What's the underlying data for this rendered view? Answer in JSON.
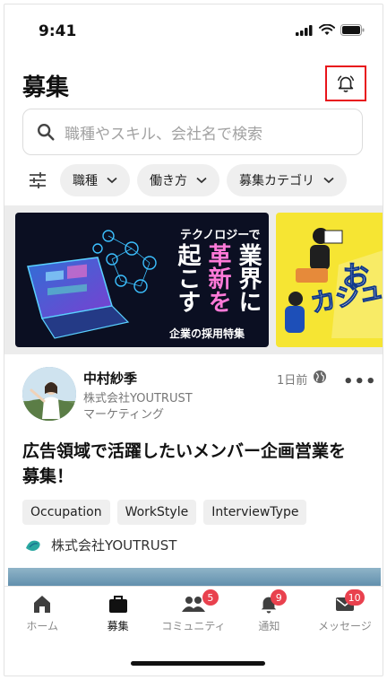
{
  "status_bar": {
    "time": "9:41"
  },
  "header": {
    "title": "募集"
  },
  "search": {
    "placeholder": "職種やスキル、会社名で検索"
  },
  "filters": [
    {
      "label": "職種"
    },
    {
      "label": "働き方"
    },
    {
      "label": "募集カテゴリ"
    }
  ],
  "banners": [
    {
      "top_text": "テクノロジーで",
      "columns": [
        "起こす",
        "革新を",
        "業界に"
      ],
      "bottom_text": "企業の採用特集"
    },
    {
      "text_line1": "お",
      "text_line2": "カジュ"
    }
  ],
  "post": {
    "author_name": "中村紗季",
    "company": "株式会社YOUTRUST",
    "role": "マーケティング",
    "time": "1日前",
    "more": "•••",
    "title": "広告領域で活躍したいメンバー企画営業を募集！",
    "tags": [
      "Occupation",
      "WorkStyle",
      "InterviewType"
    ],
    "company_link": "株式会社YOUTRUST"
  },
  "tabbar": {
    "items": [
      {
        "label": "ホーム",
        "icon": "home-icon",
        "active": false,
        "badge": ""
      },
      {
        "label": "募集",
        "icon": "briefcase-icon",
        "active": true,
        "badge": ""
      },
      {
        "label": "コミュニティ",
        "icon": "community-icon",
        "active": false,
        "badge": "5"
      },
      {
        "label": "通知",
        "icon": "bell-icon",
        "active": false,
        "badge": "9"
      },
      {
        "label": "メッセージ",
        "icon": "mail-icon",
        "active": false,
        "badge": "10"
      }
    ]
  },
  "colors": {
    "highlight_border": "#e8141b",
    "badge": "#e9414e",
    "banner_dark": "#0b0f22",
    "banner_yellow": "#f6e533"
  }
}
